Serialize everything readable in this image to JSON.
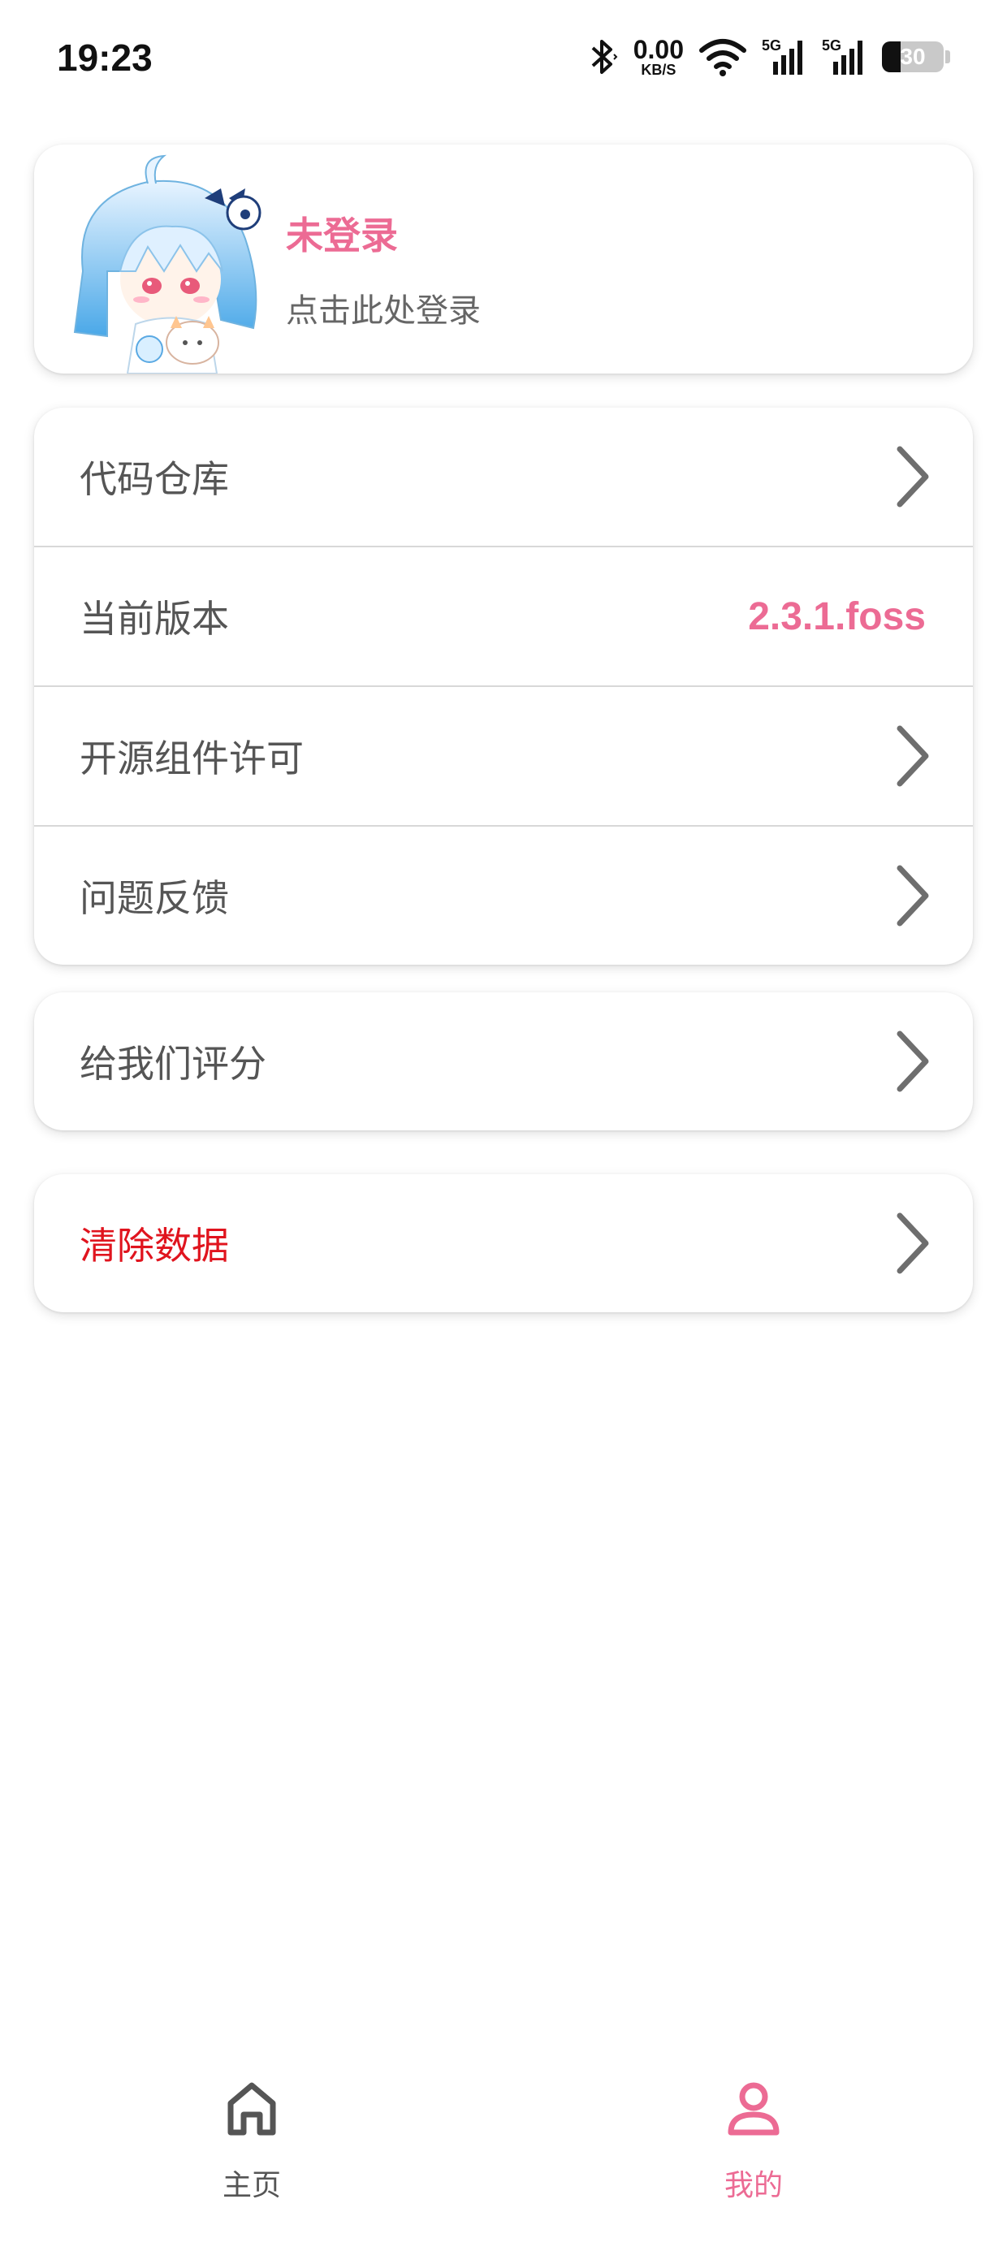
{
  "status_bar": {
    "time": "19:23",
    "net_speed_value": "0.00",
    "net_speed_unit": "KB/S",
    "sim1_label": "5G",
    "sim2_label": "5G",
    "battery_level": "30",
    "battery_fraction": 0.3
  },
  "profile": {
    "name": "未登录",
    "hint": "点击此处登录"
  },
  "menu_main": [
    {
      "label": "代码仓库",
      "type": "link"
    },
    {
      "label": "当前版本",
      "type": "value",
      "value": "2.3.1.foss"
    },
    {
      "label": "开源组件许可",
      "type": "link"
    },
    {
      "label": "问题反馈",
      "type": "link"
    }
  ],
  "menu_rate": {
    "label": "给我们评分"
  },
  "menu_clear": {
    "label": "清除数据"
  },
  "nav": {
    "home_label": "主页",
    "mine_label": "我的"
  },
  "colors": {
    "accent": "#ec6b94",
    "danger": "#e0141e",
    "text_secondary": "#555555"
  },
  "icons": {
    "chevron": "chevron-right-icon",
    "home": "home-icon",
    "mine": "user-icon",
    "bluetooth": "bluetooth-icon",
    "wifi": "wifi-icon",
    "signal": "signal-icon",
    "battery": "battery-icon"
  }
}
